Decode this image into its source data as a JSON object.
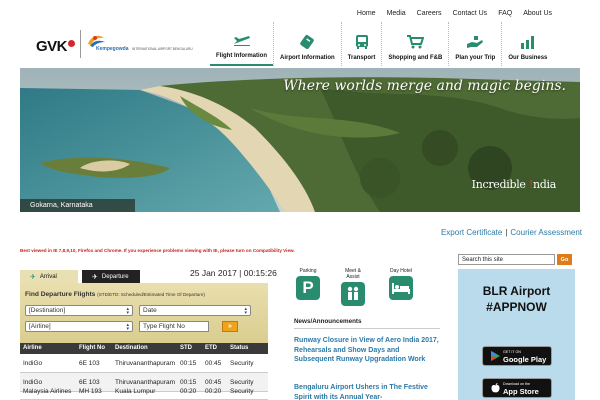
{
  "top_nav": [
    "Home",
    "Media",
    "Careers",
    "Contact Us",
    "FAQ",
    "About Us"
  ],
  "logos": {
    "gvk": "GVK",
    "airport_name": "Kempegowda",
    "airport_sub": "INTERNATIONAL AIRPORT BENGALURU"
  },
  "main_nav": [
    {
      "label": "Flight Information",
      "icon": "plane-icon"
    },
    {
      "label": "Airport Information",
      "icon": "ticket-icon"
    },
    {
      "label": "Transport",
      "icon": "bus-icon"
    },
    {
      "label": "Shopping and F&B",
      "icon": "cart-icon"
    },
    {
      "label": "Plan your Trip",
      "icon": "hand-icon"
    },
    {
      "label": "Our Business",
      "icon": "bar-chart-icon"
    }
  ],
  "hero": {
    "tagline": "Where worlds merge and magic begins.",
    "brand": "Incredible India",
    "brand_prefix": "Incredible",
    "brand_mark": "!",
    "brand_suffix": "ndia",
    "caption": "Gokarna, Karnataka"
  },
  "util_links": {
    "export": "Export Certificate",
    "sep": "|",
    "courier": "Courier Assessment"
  },
  "compat_notice": "Best viewed in IE 7,8,9,10, Firefox and Chrome. If you experience problems viewing with IE, please turn on Compatibility View.",
  "flight_panel": {
    "tabs": [
      {
        "label": "Arrival",
        "active": true
      },
      {
        "label": "Departure",
        "active": false
      }
    ],
    "datetime": "25 Jan 2017 | 00:15:26",
    "title": "Find Departure Flights",
    "title_note": "(STD/ETD: Scheduled/Estimated Time Of Departure)",
    "destination": "[Destination]",
    "date": "Date",
    "airline": "[Airline]",
    "flight_no_placeholder": "Type Flight No",
    "go": "»",
    "columns": [
      "Airline",
      "Flight No",
      "Destination",
      "STD",
      "ETD",
      "Status"
    ],
    "rows": [
      [
        "IndiGo",
        "6E 103",
        "Thiruvananthapuram",
        "00:15",
        "00:45",
        "Security"
      ],
      [
        "IndiGo",
        "6E 103",
        "Thiruvananthapuram",
        "00:15",
        "00:45",
        "Security"
      ],
      [
        "Malaysia Airlines",
        "MH 193",
        "Kuala Lumpur",
        "00:20",
        "00:20",
        "Security"
      ]
    ]
  },
  "services": [
    {
      "label": "Parking",
      "icon": "parking-icon"
    },
    {
      "label": "Meet & Assist",
      "icon": "assist-icon"
    },
    {
      "label": "Day Hotel",
      "icon": "bed-icon"
    }
  ],
  "news": {
    "heading": "News/Announcements",
    "items": [
      "Runway Closure in View of Aero India 2017, Rehearsals and Show Days and Subsequent Runway Upgradation Work",
      "Bengaluru Airport Ushers in The Festive Spirit with its Annual Year-"
    ]
  },
  "search": {
    "value": "Search this site",
    "button": "Go"
  },
  "app_panel": {
    "line1": "BLR Airport",
    "line2": "#APPNOW",
    "google_small": "GET IT ON",
    "google_big": "Google Play",
    "apple_small": "Download on the",
    "apple_big": "App Store"
  },
  "colors": {
    "accent_green": "#2a8c6e",
    "link_blue": "#2a7aa8",
    "panel_tan": "#e9dfae",
    "app_blue": "#b9dbec",
    "notice_red": "#cc1f1f",
    "go_orange": "#e07b1a"
  }
}
